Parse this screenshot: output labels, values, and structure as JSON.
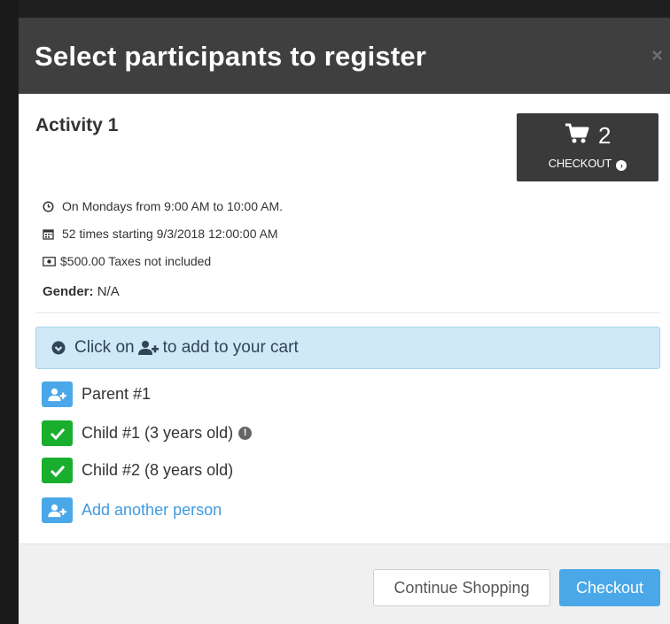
{
  "modal": {
    "title": "Select participants to register",
    "close": "×"
  },
  "activity": {
    "name": "Activity 1",
    "schedule": "On Mondays from 9:00 AM to 10:00 AM.",
    "occurrences": "52 times starting 9/3/2018 12:00:00 AM",
    "price": "$500.00 Taxes not included",
    "gender_label": "Gender:",
    "gender_value": "N/A"
  },
  "cart": {
    "count": "2",
    "checkout_label": "CHECKOUT"
  },
  "alert": {
    "prefix": "Click on",
    "suffix": "to add to your cart"
  },
  "people": [
    {
      "name": "Parent #1",
      "state": "add"
    },
    {
      "name": "Child #1 (3 years old)",
      "state": "added"
    },
    {
      "name": "Child #2 (8 years old)",
      "state": "added"
    }
  ],
  "add_person": "Add another person",
  "footer": {
    "continue_label": "Continue Shopping",
    "checkout_label": "Checkout"
  },
  "colors": {
    "header_bg": "#3f3f3f",
    "accent_blue": "#4aa8e8",
    "success_green": "#1aae2e",
    "alert_bg": "#cfe9f7"
  }
}
